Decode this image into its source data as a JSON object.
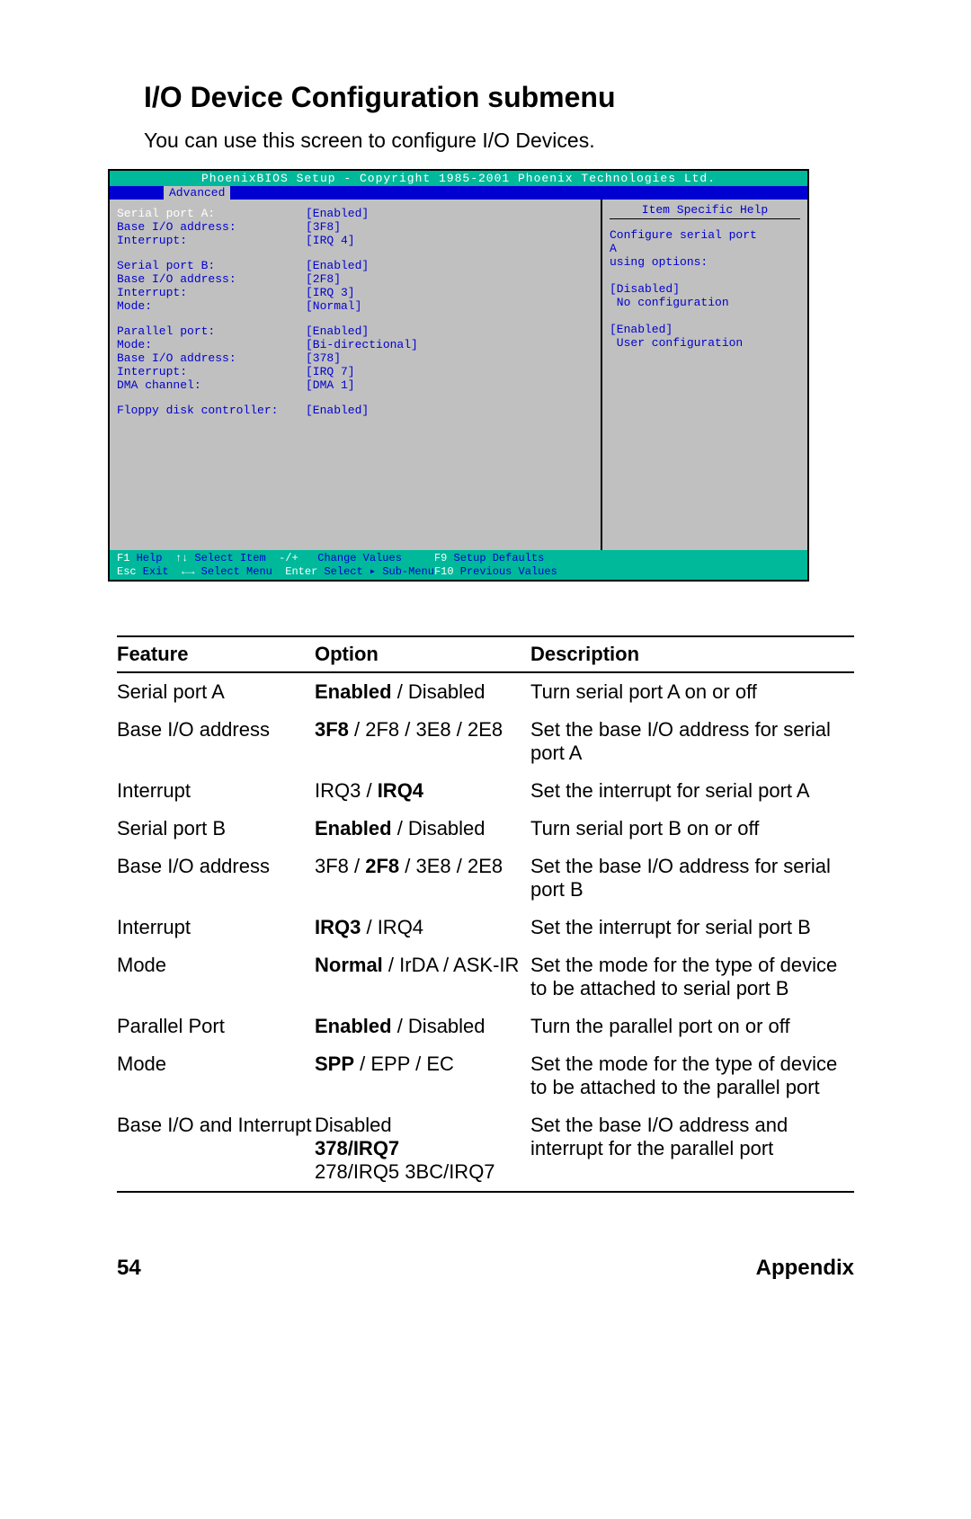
{
  "heading": "I/O Device Configuration submenu",
  "intro": "You can use this screen to configure I/O Devices.",
  "bios": {
    "titlebar": "PhoenixBIOS Setup - Copyright 1985-2001 Phoenix Technologies Ltd.",
    "tab": "Advanced",
    "help_title": "Item Specific Help",
    "help_body": "Configure serial port\nA\nusing options:\n\n[Disabled]\n No configuration\n\n[Enabled]\n User configuration",
    "rows_a": [
      {
        "label": "Serial port A:",
        "val": "[Enabled]",
        "sel": true
      },
      {
        "label": "Base I/O address:",
        "val": "[3F8]"
      },
      {
        "label": "Interrupt:",
        "val": "[IRQ 4]"
      }
    ],
    "rows_b": [
      {
        "label": "Serial port B:",
        "val": "[Enabled]"
      },
      {
        "label": "Base I/O address:",
        "val": "[2F8]"
      },
      {
        "label": "Interrupt:",
        "val": "[IRQ 3]"
      },
      {
        "label": "Mode:",
        "val": "[Normal]"
      }
    ],
    "rows_c": [
      {
        "label": "Parallel port:",
        "val": "[Enabled]"
      },
      {
        "label": "Mode:",
        "val": "[Bi-directional]"
      },
      {
        "label": "Base I/O address:",
        "val": "[378]"
      },
      {
        "label": "Interrupt:",
        "val": "[IRQ 7]"
      },
      {
        "label": "DMA channel:",
        "val": "[DMA 1]"
      }
    ],
    "rows_d": [
      {
        "label": "Floppy disk controller:",
        "val": "[Enabled]"
      }
    ],
    "footer": {
      "f1": "F1",
      "help": " Help  ",
      "arrows_v": "↑↓",
      "sel_item": " Select Item  ",
      "pm": "-/+",
      "chg": "   Change Values     ",
      "f9": "F9",
      "defaults": " Setup Defaults",
      "esc": "Esc",
      "exit": " Exit  ",
      "arrows_h": "←→",
      "sel_menu": " Select Menu  ",
      "enter": "Enter",
      "sub": " Select ▸ Sub-Menu",
      "f10": "F10",
      "prev": " Previous Values"
    }
  },
  "table": {
    "headers": {
      "feature": "Feature",
      "option": "Option",
      "desc": "Description"
    },
    "rows": [
      {
        "feature": "Serial port A",
        "option": "<b>Enabled</b> / Disabled",
        "desc": "Turn serial port A on or off"
      },
      {
        "feature": "Base I/O address",
        "option": "<b>3F8</b> / 2F8 / 3E8 / 2E8",
        "desc": "Set the base I/O address for serial port A"
      },
      {
        "feature": "Interrupt",
        "option": "IRQ3 / <b>IRQ4</b>",
        "desc": "Set the interrupt for serial port A"
      },
      {
        "feature": "Serial port B",
        "option": "<b>Enabled</b> / Disabled",
        "desc": "Turn serial port B on or off"
      },
      {
        "feature": "Base I/O address",
        "option": "3F8 / <b>2F8</b> / 3E8 / 2E8",
        "desc": "Set the base I/O address for serial port B"
      },
      {
        "feature": "Interrupt",
        "option": "<b>IRQ3</b> / IRQ4",
        "desc": "Set the interrupt for serial port B"
      },
      {
        "feature": "Mode",
        "option": "<b>Normal</b> / IrDA / ASK-IR",
        "desc": "Set the mode for the type of device to be attached to serial port B"
      },
      {
        "feature": "Parallel Port",
        "option": "<b>Enabled</b> / Disabled",
        "desc": "Turn the parallel port on or off"
      },
      {
        "feature": "Mode",
        "option": "<b>SPP</b> / EPP / EC",
        "desc": "Set the mode for the type of device to be attached to the parallel port"
      },
      {
        "feature": "Base I/O and Interrupt",
        "option": "Disabled<br><b>378/IRQ7</b><br>278/IRQ5 3BC/IRQ7",
        "desc": "Set the base I/O address and interrupt for the parallel port"
      }
    ]
  },
  "footer": {
    "page": "54",
    "section": "Appendix"
  }
}
